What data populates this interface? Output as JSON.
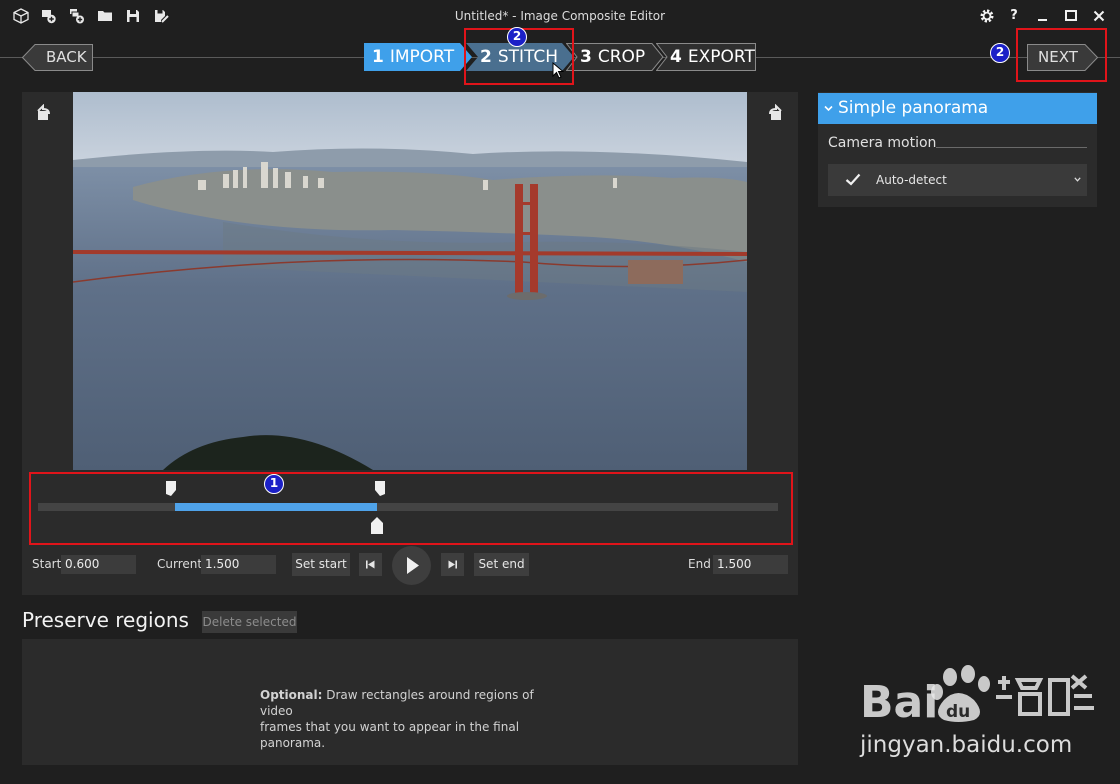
{
  "window": {
    "title": "Untitled* - Image Composite Editor",
    "toolbar_icons": [
      "cube-icon",
      "camera-add-icon",
      "images-add-icon",
      "folder-icon",
      "save-icon",
      "save-as-icon"
    ],
    "controls": [
      "settings-icon",
      "help-icon",
      "minimize-icon",
      "maximize-icon",
      "close-icon"
    ]
  },
  "nav": {
    "back_label": "BACK",
    "next_label": "NEXT",
    "steps": [
      {
        "num": "1",
        "label": "IMPORT",
        "state": "completed"
      },
      {
        "num": "2",
        "label": "STITCH",
        "state": "active"
      },
      {
        "num": "3",
        "label": "CROP",
        "state": "pending"
      },
      {
        "num": "4",
        "label": "EXPORT",
        "state": "pending"
      }
    ]
  },
  "annotations": {
    "badge_timeline": "1",
    "badge_stitch": "2",
    "badge_next": "2"
  },
  "video": {
    "scene": "Golden Gate Bridge and San Francisco skyline over the bay"
  },
  "timeline": {
    "selection_start_fraction": 0.185,
    "selection_end_fraction": 0.458,
    "current_fraction": 0.458
  },
  "controls": {
    "start_label": "Start",
    "start_value": "0.600",
    "current_label": "Current",
    "current_value": "1.500",
    "set_start": "Set start",
    "set_end": "Set end",
    "end_label": "End",
    "end_value": "1.500"
  },
  "preserve": {
    "title": "Preserve regions",
    "delete_button": "Delete selected",
    "hint_bold": "Optional:",
    "hint_line1": " Draw rectangles around regions of video",
    "hint_line2": "frames that you want to appear in the final panorama."
  },
  "sidebar": {
    "section_title": "Simple panorama",
    "camera_motion_label": "Camera motion",
    "camera_motion_value": "Auto-detect"
  },
  "watermark": {
    "text": "jingyan.baidu.com"
  },
  "colors": {
    "accent": "#3fa0ea",
    "annotation_red": "#e0141a",
    "badge_blue": "#1b20c7",
    "background": "#1f1f1f"
  }
}
